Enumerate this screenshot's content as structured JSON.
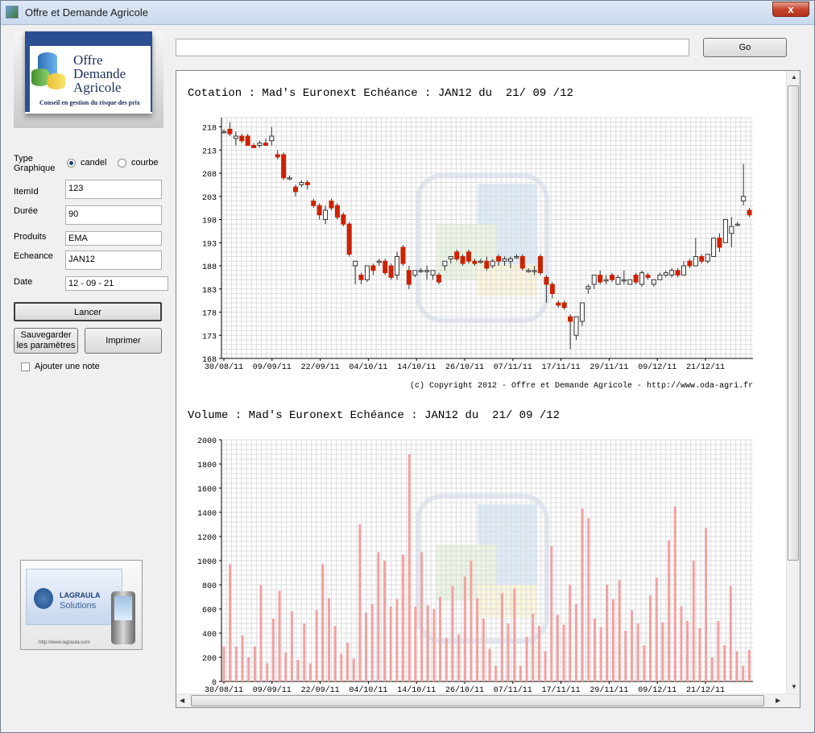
{
  "window": {
    "title": "Offre et Demande Agricole",
    "close_label": "x"
  },
  "logo": {
    "line1": "Offre",
    "amp": "&",
    "line2": "Demande",
    "line3": "Agricole",
    "tagline": "Conseil en gestion du risque des prix"
  },
  "form": {
    "type_label": "Type\nGraphique",
    "radio_candel": "candel",
    "radio_courbe": "courbe",
    "selected_type": "candel",
    "itemid_label": "ItemId",
    "itemid_value": "123",
    "duree_label": "Durée",
    "duree_value": "90",
    "produits_label": "Produits",
    "produits_value": "EMA",
    "echeance_label": "Echeance",
    "echeance_value": "JAN12",
    "date_label": "Date",
    "date_value": "12 - 09 - 21",
    "lancer_label": "Lancer",
    "sauvegarder_label": "Sauvegarder\nles paramètres",
    "imprimer_label": "Imprimer",
    "note_label": "Ajouter une note",
    "note_checked": false
  },
  "search": {
    "value": "",
    "go_label": "Go"
  },
  "lagraula": {
    "brand": "LAGRAULA",
    "sub": "Solutions",
    "url": "http://www.lagraula.com"
  },
  "charts": {
    "cotation_title": "Cotation : Mad's Euronext Echéance : JAN12 du  21/ 09 /12",
    "volume_title": "Volume : Mad's Euronext Echéance : JAN12 du  21/ 09 /12",
    "copyright": "(c) Copyright 2012 - Offre et Demande Agricole - http://www.oda-agri.fr"
  },
  "chart_data": [
    {
      "type": "candlestick",
      "title": "Cotation : Mad's Euronext Echéance : JAN12 du  21/ 09 /12",
      "ylim": [
        168,
        220
      ],
      "yticks": [
        168,
        173,
        178,
        183,
        188,
        193,
        198,
        203,
        208,
        213,
        218
      ],
      "xticks": [
        "30/08/11",
        "09/09/11",
        "22/09/11",
        "04/10/11",
        "14/10/11",
        "26/10/11",
        "07/11/11",
        "17/11/11",
        "29/11/11",
        "09/12/11",
        "21/12/11"
      ],
      "up_color": "#ffffff",
      "down_color": "#cc2200",
      "grid": true,
      "candles": [
        [
          217,
          217.5,
          216.5,
          217
        ],
        [
          217.5,
          219,
          216,
          216.5
        ],
        [
          215.5,
          217,
          214,
          216
        ],
        [
          216,
          216.5,
          214.5,
          215
        ],
        [
          216,
          216.5,
          214,
          214
        ],
        [
          214,
          214.5,
          213.5,
          213.5
        ],
        [
          214,
          215,
          213.5,
          214.5
        ],
        [
          214.5,
          215.5,
          214,
          214
        ],
        [
          215,
          218,
          214,
          216
        ],
        [
          212,
          213,
          211,
          211.5
        ],
        [
          212,
          212.5,
          206.5,
          207
        ],
        [
          207,
          207.5,
          206.5,
          207
        ],
        [
          205,
          205.5,
          203,
          204
        ],
        [
          205.5,
          206.5,
          205,
          206
        ],
        [
          206,
          206.5,
          204.5,
          205.5
        ],
        [
          202,
          202.5,
          200.5,
          201
        ],
        [
          201,
          201.5,
          198,
          199
        ],
        [
          198,
          201,
          197,
          200
        ],
        [
          202,
          202.5,
          200,
          200.5
        ],
        [
          201,
          201.5,
          198,
          198.5
        ],
        [
          199,
          199.5,
          196.5,
          197
        ],
        [
          197,
          197.5,
          190,
          190.5
        ],
        [
          188,
          189,
          184,
          189
        ],
        [
          186,
          186.5,
          184,
          185
        ],
        [
          185,
          188,
          184.5,
          188
        ],
        [
          188,
          188.5,
          186,
          187
        ],
        [
          189,
          189.5,
          188,
          189
        ],
        [
          189,
          189.5,
          186,
          186.5
        ],
        [
          188,
          188.5,
          185,
          185.5
        ],
        [
          186,
          191,
          185,
          190
        ],
        [
          192,
          192.5,
          188,
          188.5
        ],
        [
          187,
          188,
          183,
          184
        ],
        [
          186,
          187,
          185.5,
          187
        ],
        [
          187,
          187.5,
          186.5,
          187
        ],
        [
          187,
          188,
          185,
          187
        ],
        [
          186,
          187,
          185,
          187
        ],
        [
          186,
          186.5,
          184,
          184.5
        ],
        [
          188,
          189,
          187,
          189
        ],
        [
          189.5,
          190,
          188.5,
          190
        ],
        [
          191,
          191.5,
          189,
          189.5
        ],
        [
          190,
          190.5,
          188,
          188.5
        ],
        [
          191,
          191.5,
          188.5,
          189
        ],
        [
          189,
          189.5,
          188,
          188.5
        ],
        [
          189,
          189.5,
          188.5,
          189
        ],
        [
          189,
          190,
          187,
          187.5
        ],
        [
          188,
          189.5,
          187.5,
          189
        ],
        [
          190,
          190.5,
          188,
          189
        ],
        [
          189,
          190,
          188,
          189.5
        ],
        [
          189,
          190,
          187.5,
          189.5
        ],
        [
          190,
          190.5,
          189.5,
          190
        ],
        [
          190,
          190.5,
          187,
          187.5
        ],
        [
          187,
          187.5,
          186.5,
          187
        ],
        [
          187,
          188,
          186,
          187
        ],
        [
          190,
          190.5,
          186,
          186.5
        ],
        [
          185.5,
          186,
          180,
          184
        ],
        [
          184,
          184.5,
          181,
          182
        ],
        [
          180,
          180.5,
          179,
          179.5
        ],
        [
          180,
          180.5,
          178.5,
          179
        ],
        [
          177,
          177.5,
          170,
          176
        ],
        [
          173,
          177,
          172,
          177
        ],
        [
          176,
          180,
          175,
          180
        ],
        [
          183,
          184,
          182,
          183.5
        ],
        [
          184,
          186,
          183,
          186
        ],
        [
          186,
          187,
          184,
          184.5
        ],
        [
          185,
          186,
          184,
          185
        ],
        [
          186,
          186.5,
          184.5,
          185
        ],
        [
          184,
          186,
          184,
          185.5
        ],
        [
          185,
          187,
          184,
          185
        ],
        [
          184,
          185,
          184,
          185
        ],
        [
          186,
          186.5,
          184,
          184.5
        ],
        [
          184,
          187,
          183.5,
          186.5
        ],
        [
          186,
          186.5,
          185,
          185.5
        ],
        [
          184,
          185,
          183.5,
          185
        ],
        [
          185,
          186.5,
          185,
          186
        ],
        [
          186,
          187,
          185.5,
          186.5
        ],
        [
          186,
          187.5,
          185.5,
          187
        ],
        [
          187,
          187.5,
          185.5,
          186
        ],
        [
          186,
          189,
          186,
          188
        ],
        [
          189,
          189.5,
          187.5,
          188
        ],
        [
          188,
          194,
          188,
          190
        ],
        [
          190,
          190.5,
          188.5,
          189
        ],
        [
          189,
          190.5,
          188.5,
          190.5
        ],
        [
          190,
          194,
          190,
          194
        ],
        [
          194,
          195,
          191,
          192
        ],
        [
          193,
          198,
          193,
          198
        ],
        [
          195,
          198.5,
          192,
          196.5
        ],
        [
          197,
          197.5,
          196.5,
          197
        ],
        [
          202,
          210,
          201,
          203
        ],
        [
          200,
          200.5,
          198.5,
          199
        ]
      ]
    },
    {
      "type": "bar",
      "title": "Volume : Mad's Euronext Echéance : JAN12 du  21/ 09 /12",
      "ylim": [
        0,
        2000
      ],
      "yticks": [
        0,
        200,
        400,
        600,
        800,
        1000,
        1200,
        1400,
        1600,
        1800,
        2000
      ],
      "xticks": [
        "30/08/11",
        "09/09/11",
        "22/09/11",
        "04/10/11",
        "14/10/11",
        "26/10/11",
        "07/11/11",
        "17/11/11",
        "29/11/11",
        "09/12/11",
        "21/12/11"
      ],
      "bar_color": "#f2a2a2",
      "grid": true,
      "values": [
        290,
        970,
        290,
        380,
        200,
        290,
        800,
        150,
        520,
        750,
        240,
        580,
        180,
        480,
        150,
        590,
        970,
        690,
        460,
        230,
        320,
        190,
        1300,
        570,
        640,
        1070,
        1000,
        620,
        680,
        1050,
        1880,
        620,
        1070,
        630,
        600,
        700,
        360,
        790,
        390,
        870,
        1000,
        690,
        520,
        270,
        130,
        730,
        480,
        770,
        130,
        370,
        560,
        460,
        250,
        1120,
        550,
        470,
        800,
        640,
        1430,
        1350,
        520,
        450,
        800,
        680,
        840,
        420,
        590,
        480,
        300,
        710,
        860,
        490,
        1170,
        1450,
        620,
        500,
        1000,
        440,
        1270,
        200,
        500,
        300,
        790,
        250,
        130,
        260
      ]
    }
  ]
}
